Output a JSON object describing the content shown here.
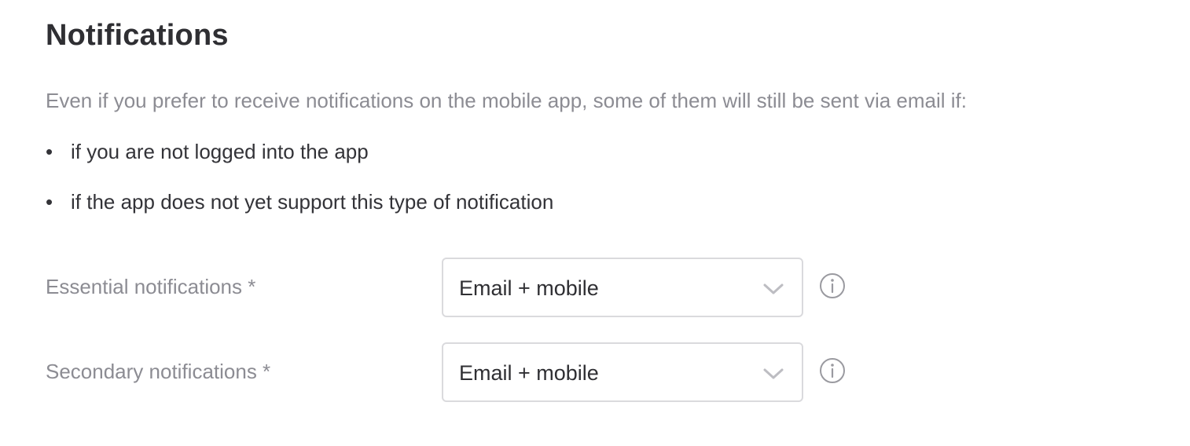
{
  "section": {
    "title": "Notifications",
    "intro": "Even if you prefer to receive notifications on the mobile app, some of them will still be sent via email if:",
    "bullets": [
      {
        "marker": "•",
        "text": "if you are not logged into the app"
      },
      {
        "marker": "•",
        "text": "if the app does not yet support this type of notification"
      }
    ]
  },
  "fields": {
    "essential": {
      "label": "Essential notifications *",
      "value": "Email + mobile",
      "icon": "chevron-down-icon",
      "info_icon": "info-icon"
    },
    "secondary": {
      "label": "Secondary notifications *",
      "value": "Email + mobile",
      "icon": "chevron-down-icon",
      "info_icon": "info-icon"
    }
  },
  "colors": {
    "title": "#2f2f33",
    "muted_text": "#8c8c93",
    "body_text": "#333338",
    "border": "#dadadd",
    "icon": "#9a9aa0"
  }
}
